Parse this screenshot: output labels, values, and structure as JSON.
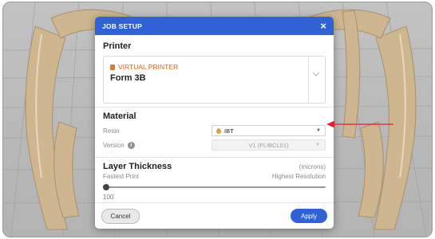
{
  "dialog": {
    "title": "JOB SETUP",
    "close_glyph": "×",
    "printer": {
      "heading": "Printer",
      "type_label": "VIRTUAL PRINTER",
      "model": "Form 3B",
      "type_icon": "printer-icon"
    },
    "material": {
      "heading": "Material",
      "resin_label": "Resin",
      "resin_value": "IBT",
      "resin_icon": "resin-drop-icon",
      "version_label": "Version",
      "version_value": "V1 (FLIBCL01)"
    },
    "layer_thickness": {
      "heading": "Layer Thickness",
      "units": "(microns)",
      "left_label": "Fastest Print",
      "right_label": "Highest Resolution",
      "value": "100",
      "slider_fraction": 0
    },
    "cancel_label": "Cancel",
    "apply_label": "Apply"
  },
  "colors": {
    "accent": "#2f62d6",
    "annotation_arrow": "#e0212b",
    "resin_drop": "#d9a53b",
    "printer_label": "#d8651f"
  }
}
